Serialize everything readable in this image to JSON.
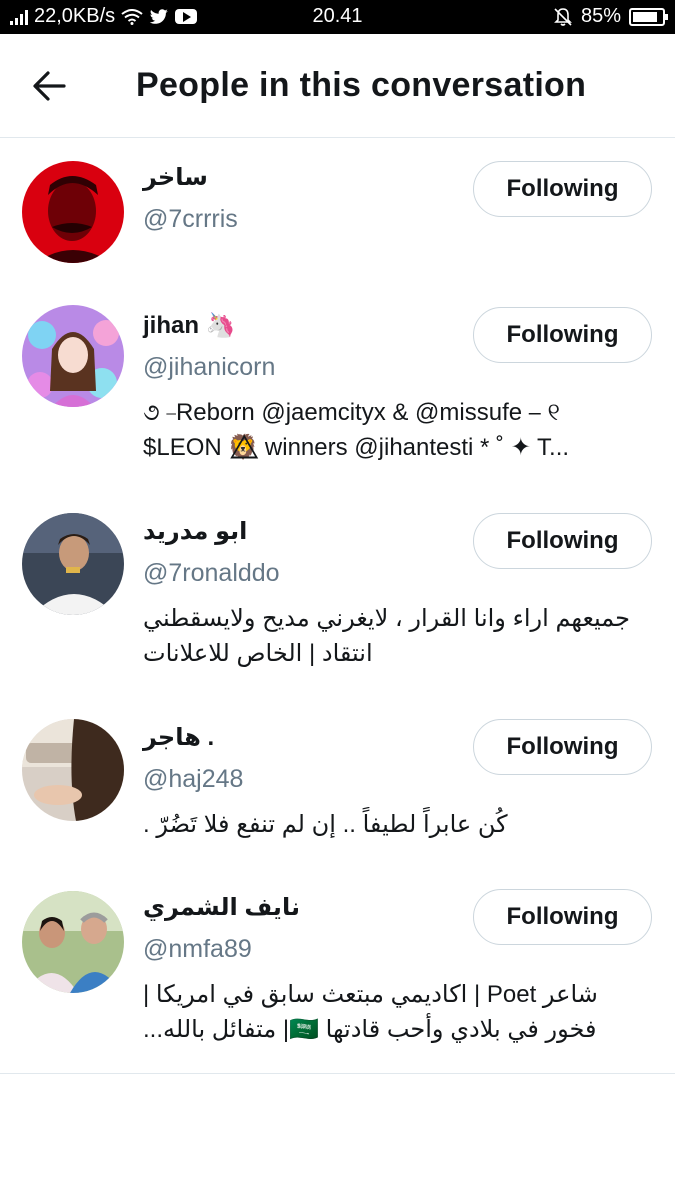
{
  "status_bar": {
    "speed": "22,0KB/s",
    "time": "20.41",
    "battery": "85%",
    "battery_level": 0.85
  },
  "header": {
    "title": "People in this conversation"
  },
  "people": [
    {
      "name": "ساخر",
      "handle": "@7crrris",
      "bio_lines": [],
      "button": "Following"
    },
    {
      "name": "jihan 🦄",
      "handle": "@jihanicorn",
      "bio_lines": [
        "૭ ⎯Reborn @jaemcityx & @missufe ⎯ ୧",
        "$LEON 🦁⃤ winners @jihantesti * ˚ ✦ T..."
      ],
      "button": "Following"
    },
    {
      "name": "ابو مدريد",
      "handle": "@7ronalddo",
      "bio_lines": [
        "جميعهم اراء وانا القرار ، لايغرني مديح ولايسقطني",
        "انتقاد | الخاص للاعلانات"
      ],
      "button": "Following"
    },
    {
      "name": "هاجر .",
      "handle": "@haj248",
      "bio_lines": [
        "كُن عابراً لطيفاً .. إن لم تنفع فلا تَضُرّ ."
      ],
      "button": "Following"
    },
    {
      "name": "نايف الشمري",
      "handle": "@nmfa89",
      "bio_lines": [
        "شاعر Poet | اكاديمي مبتعث سابق في امريكا |",
        "فخور في بلادي وأحب قادتها 🇸🇦| متفائل بالله..."
      ],
      "button": "Following"
    }
  ]
}
